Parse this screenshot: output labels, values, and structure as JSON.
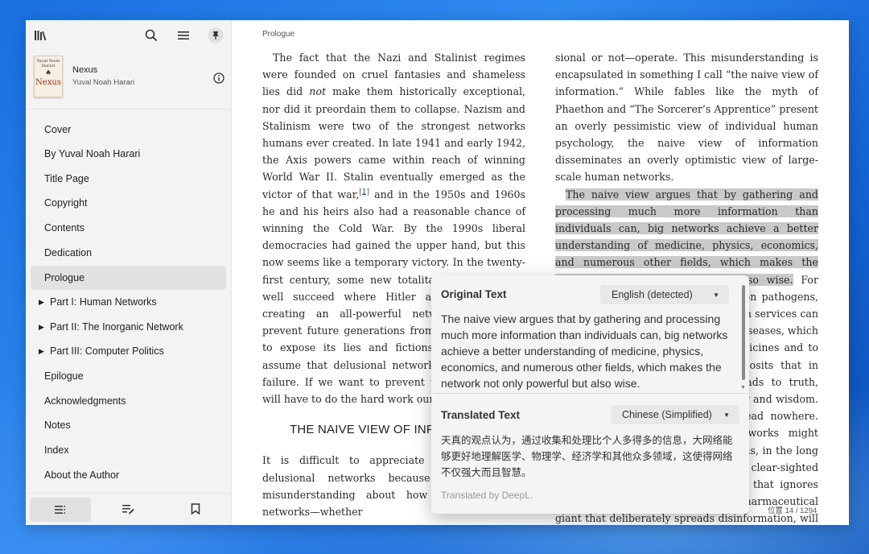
{
  "sidebar": {
    "book": {
      "cover_author": "Yuval Noah Harari",
      "cover_title": "Nexus",
      "title": "Nexus",
      "author": "Yuval Noah Harari"
    },
    "toc": [
      {
        "label": "Cover",
        "expandable": false
      },
      {
        "label": "By Yuval Noah Harari",
        "expandable": false
      },
      {
        "label": "Title Page",
        "expandable": false
      },
      {
        "label": "Copyright",
        "expandable": false
      },
      {
        "label": "Contents",
        "expandable": false
      },
      {
        "label": "Dedication",
        "expandable": false
      },
      {
        "label": "Prologue",
        "expandable": false,
        "active": true
      },
      {
        "label": "Part I: Human Networks",
        "expandable": true
      },
      {
        "label": "Part II: The Inorganic Network",
        "expandable": true
      },
      {
        "label": "Part III: Computer Politics",
        "expandable": true
      },
      {
        "label": "Epilogue",
        "expandable": false
      },
      {
        "label": "Acknowledgments",
        "expandable": false
      },
      {
        "label": "Notes",
        "expandable": false
      },
      {
        "label": "Index",
        "expandable": false
      },
      {
        "label": "About the Author",
        "expandable": false
      }
    ],
    "icons": {
      "library": "library-icon",
      "search": "search-icon",
      "menu": "menu-icon",
      "pin": "pin-icon",
      "info": "info-icon",
      "toc_tab": "toc-list-icon",
      "notes_tab": "notes-edit-icon",
      "bookmark_tab": "bookmark-icon"
    }
  },
  "reader": {
    "chapter": "Prologue",
    "left_column": {
      "p1_a": "The fact that the Nazi and Stalinist regimes were founded on cruel fantasies and shameless lies did ",
      "p1_em": "not",
      "p1_b": " make them historically exceptional, nor did it preordain them to collapse. Nazism and Stalinism were two of the strongest networks humans ever created. In late 1941 and early 1942, the Axis powers came within reach of winning World War II. Stalin eventually emerged as the victor of that war,",
      "p1_fn": "[1]",
      "p1_c": " and in the 1950s and 1960s he and his heirs also had a reasonable chance of winning the Cold War. By the 1990s liberal democracies had gained the upper hand, but this now seems like a temporary victory. In the twenty-first century, some new totalitarian regime may well succeed where Hitler and Stalin failed, creating an all-powerful network that could prevent future generations from even attempting to expose its lies and fictions. We should not assume that delusional networks are doomed to failure. If we want to prevent their triumph, we will have to do the hard work ourselves.",
      "section_heading": "THE NAIVE VIEW OF INFORMATION",
      "p2": "It is difficult to appreciate the strength of delusional networks because of a broader misunderstanding about how big information networks—whether"
    },
    "right_column": {
      "p1": "sional or not—operate. This misunderstanding is encapsulated in something I call “the naive view of information.” While fables like the myth of Phaethon and “The Sorcerer’s Apprentice” present an overly pessimistic view of individual human psychology, the naive view of information disseminates an overly optimistic view of large-scale human networks.",
      "p2_highlight": "The naive view argues that by gathering and processing much more information than individuals can, big networks achieve a better understanding of medicine, physics, economics, and numerous other fields, which makes the network not only powerful but also wise.",
      "p2_rest": " For example, by gathering information on pathogens, pharmaceutical companies and health services can determine the true causes of many diseases, which enables them to develop better medicines and to make wiser decisions. This view posits that in sufficient quantities information leads to truth, and truth in turn leads to both power and wisdom. Ignorance, in contrast, seems to lead nowhere. While delusional or deceitful networks might occasionally arise in moments of crisis, in the long term they are bound to lose to more clear-sighted and honest rivals. A health service that ignores information about pathogens, or a pharmaceutical giant that deliberately spreads disinformation, will ultimately lose out to competitors that de-"
    },
    "location": "位置 14 / 1294"
  },
  "translation_popup": {
    "source_heading": "Original Text",
    "source_language": "English (detected)",
    "source_text": "The naive view argues that by gathering and processing much more information than individuals can, big networks achieve a better understanding of medicine, physics, economics, and numerous other fields, which makes the network not only powerful but also wise.",
    "target_heading": "Translated Text",
    "target_language": "Chinese (Simplified)",
    "target_text": "天真的观点认为，通过收集和处理比个人多得多的信息，大网络能够更好地理解医学、物理学、经济学和其他众多领域，这使得网络不仅强大而且智慧。",
    "credit": "Translated by DeepL."
  }
}
